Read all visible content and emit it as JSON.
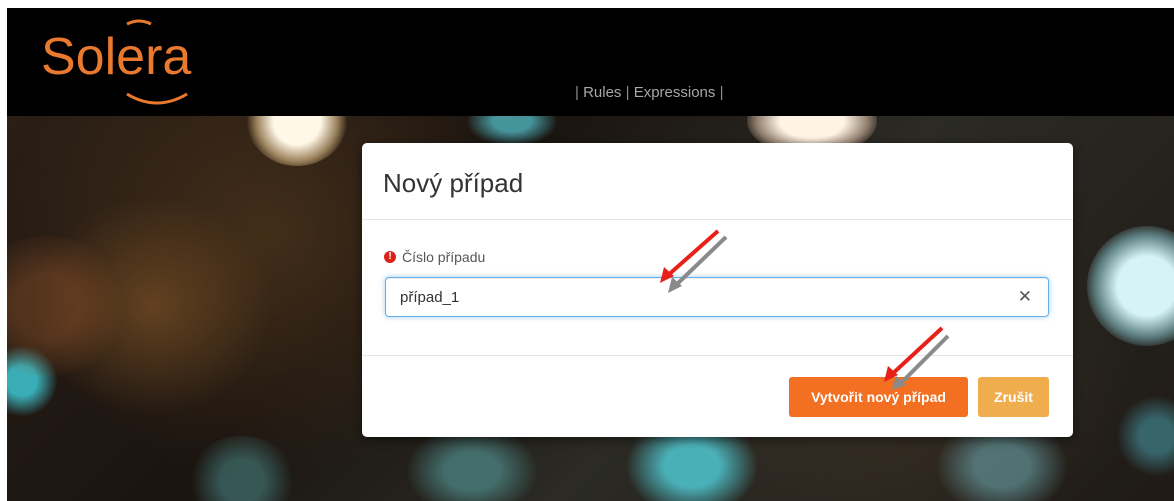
{
  "header": {
    "logo_text": "Solera",
    "nav_items": [
      "Rules",
      "Expressions"
    ],
    "nav_separator": "|"
  },
  "dialog": {
    "title": "Nový případ",
    "field_label": "Číslo případu",
    "field_value": "případ_1",
    "clear_symbol": "✕",
    "required_symbol": "!",
    "primary_button": "Vytvořit nový případ",
    "cancel_button": "Zrušit"
  },
  "colors": {
    "topbar": "#000000",
    "logo": "#e8792e",
    "primary": "#f36f21",
    "secondary": "#f0ad4e",
    "focus": "#66afe9",
    "required": "#d9241c",
    "annotation_red": "#e8201a",
    "annotation_gray": "#8a8a8a"
  },
  "icons": [
    "required-icon",
    "clear-icon",
    "annotation-arrow"
  ]
}
